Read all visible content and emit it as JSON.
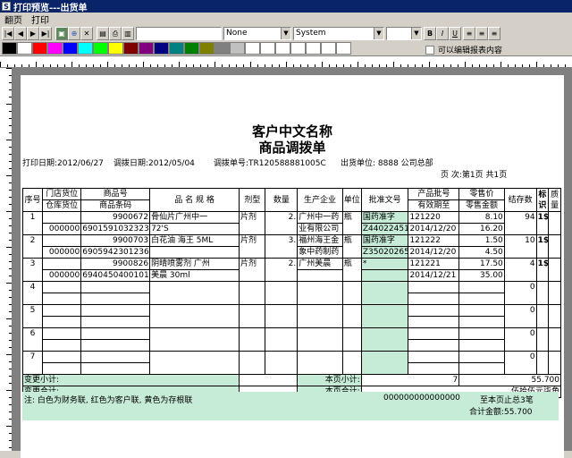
{
  "window": {
    "title": "打印预览---出货单"
  },
  "menu": [
    "翻页",
    "打印"
  ],
  "toolbar": {
    "font_name": "System",
    "style_value": "None",
    "bold": "B",
    "italic": "I",
    "underline": "U",
    "editable_label": "可以编辑报表内容"
  },
  "colors": [
    "#000000",
    "#ffffff",
    "#ff0000",
    "#ff00ff",
    "#0000ff",
    "#00ffff",
    "#00ff00",
    "#ffff00",
    "#800000",
    "#800080",
    "#000080",
    "#008080",
    "#008000",
    "#808000",
    "#808080",
    "#c0c0c0",
    "#ffffff",
    "#ffffff",
    "#ffffff",
    "#ffffff",
    "#ffffff",
    "#ffffff",
    "#ffffff"
  ],
  "report": {
    "company": "客户中文名称",
    "doc_title": "商品调拨单",
    "print_date": "打印日期:2012/06/27",
    "transfer_date": "调拨日期:2012/05/04",
    "transfer_no": "调拨单号:TR120588881005C",
    "ship_unit": "出货单位: 8888 公司总部",
    "page_info": "页    次:第1页 共1页",
    "headers": {
      "seq": "序号",
      "store_loc": "门店货位",
      "wh_loc": "仓库货位",
      "code": "商品号",
      "ext_code": "商品条码",
      "spec": "品 名 规 格",
      "form": "剂型",
      "qty": "数量",
      "maker": "生产企业",
      "unit": "单位",
      "approval": "批准文号",
      "batch": "产品批号",
      "expiry": "有效期至",
      "retail": "零售价",
      "retail_amt": "零售金额",
      "stock": "结存数",
      "mark": "标识",
      "quality": "质量"
    },
    "rows": [
      {
        "seq": "1",
        "wh": "000000",
        "code": "9900672",
        "barcode": "6901591032323",
        "name": "骨仙片广州中一",
        "spec2": "72'S",
        "form": "片剂",
        "qty": "2.",
        "maker": "广州中一药",
        "maker2": "业有限公司",
        "unit": "瓶",
        "approval": "国药准字",
        "approval2": "Z44022451",
        "batch": "121220",
        "expiry": "2014/12/20",
        "price": "8.10",
        "amount": "16.20",
        "stock": "94",
        "mark": "1$"
      },
      {
        "seq": "2",
        "wh": "000000",
        "code": "9900703",
        "barcode": "6905942301236",
        "name": "白花油 海王 5ML",
        "spec2": "",
        "form": "片剂",
        "qty": "3.",
        "maker": "福州海王金",
        "maker2": "象中药制药",
        "unit": "瓶",
        "approval": "国药准字",
        "approval2": "Z35020265",
        "batch": "121222",
        "expiry": "2014/12/20",
        "price": "1.50",
        "amount": "4.50",
        "stock": "10",
        "mark": "1$"
      },
      {
        "seq": "3",
        "wh": "000000",
        "code": "9900826",
        "barcode": "6940450400101",
        "name": "阴晴喷雾剂    广州",
        "spec2": "美晨 30ml",
        "form": "片剂",
        "qty": "2.",
        "maker": "广州美晨",
        "maker2": "",
        "unit": "瓶",
        "approval": "*",
        "approval2": "",
        "batch": "121221",
        "expiry": "2014/12/21",
        "price": "17.50",
        "amount": "35.00",
        "stock": "4",
        "mark": "1$"
      }
    ],
    "empty_rows": [
      "4",
      "5",
      "6",
      "7"
    ],
    "empty_stock": "0",
    "subtotal_label": "变更小计:",
    "page_subtotal_label": "本页小计:",
    "page_subtotal_qty": "7",
    "page_subtotal_amount": "55.700",
    "total_label": "变更合计:",
    "page_total_label": "本页合计:",
    "page_total_words": "伍拾伍元柒角",
    "note": "注: 白色为财务联, 红色为客户联, 黄色为存根联",
    "zeros": "000000000000000",
    "summary_pages": "至本页止总3笔",
    "summary_amount": "合计金额:55.700"
  }
}
